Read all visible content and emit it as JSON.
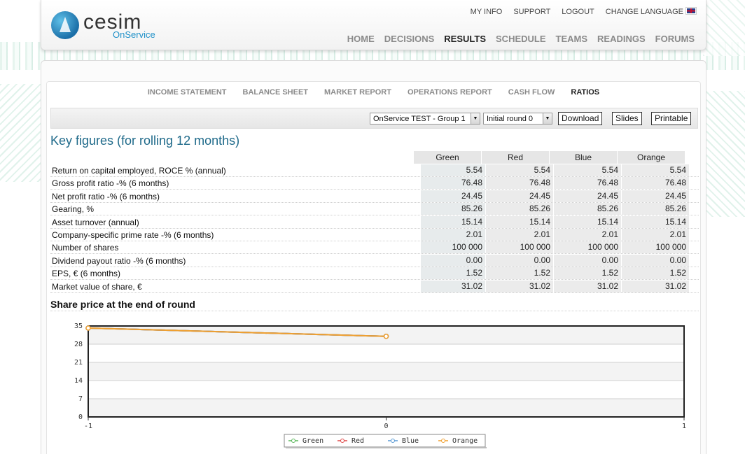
{
  "header": {
    "logo_word": "cesim",
    "logo_sub": "OnService",
    "toplinks": [
      "MY INFO",
      "SUPPORT",
      "LOGOUT",
      "CHANGE LANGUAGE"
    ],
    "nav": [
      "HOME",
      "DECISIONS",
      "RESULTS",
      "SCHEDULE",
      "TEAMS",
      "READINGS",
      "FORUMS"
    ],
    "nav_active": "RESULTS"
  },
  "subnav": {
    "items": [
      "INCOME STATEMENT",
      "BALANCE SHEET",
      "MARKET REPORT",
      "OPERATIONS REPORT",
      "CASH FLOW",
      "RATIOS"
    ],
    "active": "RATIOS"
  },
  "toolbar": {
    "group_select": "OnService TEST - Group 1",
    "round_select": "Initial round 0",
    "download": "Download",
    "slides": "Slides",
    "printable": "Printable"
  },
  "key_figures": {
    "title": "Key figures (for rolling 12 months)",
    "columns": [
      "Green",
      "Red",
      "Blue",
      "Orange"
    ],
    "rows": [
      {
        "label": "Return on capital employed, ROCE % (annual)",
        "values": [
          "5.54",
          "5.54",
          "5.54",
          "5.54"
        ]
      },
      {
        "label": "Gross profit ratio -% (6 months)",
        "values": [
          "76.48",
          "76.48",
          "76.48",
          "76.48"
        ]
      },
      {
        "label": "Net profit ratio -% (6 months)",
        "values": [
          "24.45",
          "24.45",
          "24.45",
          "24.45"
        ]
      },
      {
        "label": "Gearing, %",
        "values": [
          "85.26",
          "85.26",
          "85.26",
          "85.26"
        ]
      },
      {
        "label": "Asset turnover (annual)",
        "values": [
          "15.14",
          "15.14",
          "15.14",
          "15.14"
        ]
      },
      {
        "label": "Company-specific prime rate -% (6 months)",
        "values": [
          "2.01",
          "2.01",
          "2.01",
          "2.01"
        ]
      },
      {
        "label": "Number of shares",
        "values": [
          "100 000",
          "100 000",
          "100 000",
          "100 000"
        ]
      },
      {
        "label": "Dividend payout ratio -% (6 months)",
        "values": [
          "0.00",
          "0.00",
          "0.00",
          "0.00"
        ]
      },
      {
        "label": "EPS, € (6 months)",
        "values": [
          "1.52",
          "1.52",
          "1.52",
          "1.52"
        ]
      },
      {
        "label": "Market value of share, €",
        "values": [
          "31.02",
          "31.02",
          "31.02",
          "31.02"
        ]
      }
    ]
  },
  "chart_data": {
    "type": "line",
    "title": "Share price at the end of round",
    "xlabel": "",
    "ylabel": "",
    "x_ticks": [
      -1,
      0,
      1
    ],
    "y_ticks": [
      0,
      7,
      14,
      21,
      28,
      35
    ],
    "xlim": [
      -1,
      1
    ],
    "ylim": [
      0,
      35
    ],
    "x": [
      -1,
      0
    ],
    "series": [
      {
        "name": "Green",
        "color": "#5cb85c",
        "values": [
          34.2,
          31.02
        ]
      },
      {
        "name": "Red",
        "color": "#e04a4a",
        "values": [
          34.2,
          31.02
        ]
      },
      {
        "name": "Blue",
        "color": "#5b9bd5",
        "values": [
          34.2,
          31.02
        ]
      },
      {
        "name": "Orange",
        "color": "#f0a030",
        "values": [
          34.2,
          31.02
        ]
      }
    ],
    "grid": true,
    "legend": "bottom"
  }
}
